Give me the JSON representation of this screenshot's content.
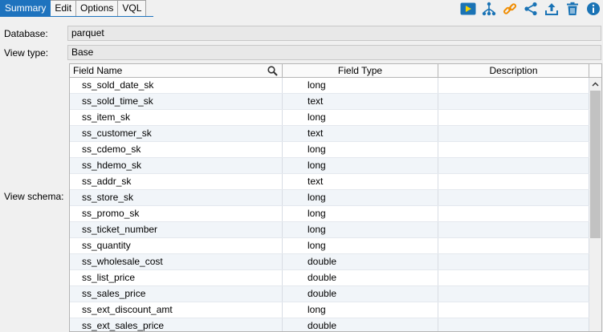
{
  "tabs": [
    {
      "label": "Summary",
      "active": true
    },
    {
      "label": "Edit"
    },
    {
      "label": "Options"
    },
    {
      "label": "VQL"
    }
  ],
  "toolbar_icons": [
    "run-icon",
    "tree-icon",
    "link-icon",
    "share-icon",
    "upload-icon",
    "trash-icon",
    "info-icon"
  ],
  "colors": {
    "accent": "#1e73be",
    "run": "#1a73b5",
    "link": "#f08c00"
  },
  "database": {
    "label": "Database:",
    "value": "parquet"
  },
  "view_type": {
    "label": "View type:",
    "value": "Base"
  },
  "view_schema": {
    "label": "View schema:",
    "columns": [
      "Field Name",
      "Field Type",
      "Description"
    ],
    "rows": [
      {
        "name": "ss_sold_date_sk",
        "type": "long",
        "description": ""
      },
      {
        "name": "ss_sold_time_sk",
        "type": "text",
        "description": ""
      },
      {
        "name": "ss_item_sk",
        "type": "long",
        "description": ""
      },
      {
        "name": "ss_customer_sk",
        "type": "text",
        "description": ""
      },
      {
        "name": "ss_cdemo_sk",
        "type": "long",
        "description": ""
      },
      {
        "name": "ss_hdemo_sk",
        "type": "long",
        "description": ""
      },
      {
        "name": "ss_addr_sk",
        "type": "text",
        "description": ""
      },
      {
        "name": "ss_store_sk",
        "type": "long",
        "description": ""
      },
      {
        "name": "ss_promo_sk",
        "type": "long",
        "description": ""
      },
      {
        "name": "ss_ticket_number",
        "type": "long",
        "description": ""
      },
      {
        "name": "ss_quantity",
        "type": "long",
        "description": ""
      },
      {
        "name": "ss_wholesale_cost",
        "type": "double",
        "description": ""
      },
      {
        "name": "ss_list_price",
        "type": "double",
        "description": ""
      },
      {
        "name": "ss_sales_price",
        "type": "double",
        "description": ""
      },
      {
        "name": "ss_ext_discount_amt",
        "type": "long",
        "description": ""
      },
      {
        "name": "ss_ext_sales_price",
        "type": "double",
        "description": ""
      }
    ]
  }
}
